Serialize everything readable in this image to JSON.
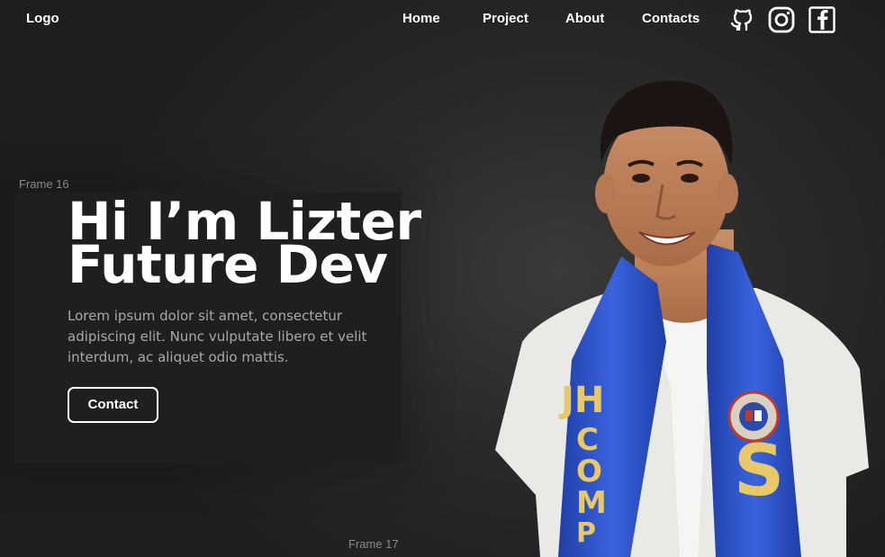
{
  "nav": {
    "logo": "Logo",
    "links": [
      "Home",
      "Project",
      "About",
      "Contacts"
    ],
    "social_icons": [
      "github-icon",
      "instagram-icon",
      "facebook-icon"
    ]
  },
  "frames": {
    "frame16": "Frame 16",
    "frame17": "Frame 17"
  },
  "hero": {
    "title_line1": "Hi I’m Lizter",
    "title_line2": "Future Dev",
    "description": "Lorem ipsum dolor sit amet, consectetur adipiscing elit. Nunc vulputate libero et velit interdum, ac aliquet odio mattis.",
    "button_label": "Contact"
  },
  "photo": {
    "stole_text_left": "JH COMPL",
    "stole_text_right": "SA"
  },
  "colors": {
    "background": "#1f1f1f",
    "text": "#ffffff",
    "muted_text": "#a8a8a8",
    "stole_blue": "#2f55c8",
    "stole_gold": "#e8c96a"
  }
}
